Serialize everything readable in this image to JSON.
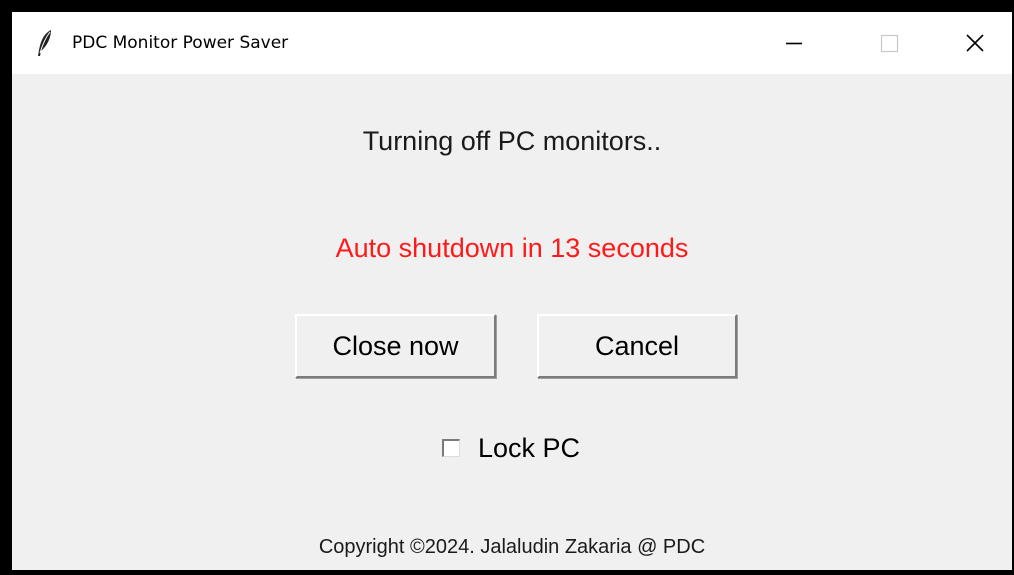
{
  "window": {
    "title": "PDC Monitor Power Saver",
    "app_icon": "feather-icon",
    "controls": {
      "minimize_icon": "minimize-icon",
      "maximize_icon": "maximize-icon",
      "close_icon": "close-icon"
    }
  },
  "main": {
    "heading": "Turning off PC monitors..",
    "countdown": "Auto shutdown in 13 seconds",
    "countdown_color": "#ff1a1a",
    "close_now_label": "Close now",
    "cancel_label": "Cancel",
    "lock_pc_label": "Lock PC",
    "lock_pc_checked": false
  },
  "footer": {
    "copyright": "Copyright ©2024. Jalaludin Zakaria @ PDC"
  }
}
